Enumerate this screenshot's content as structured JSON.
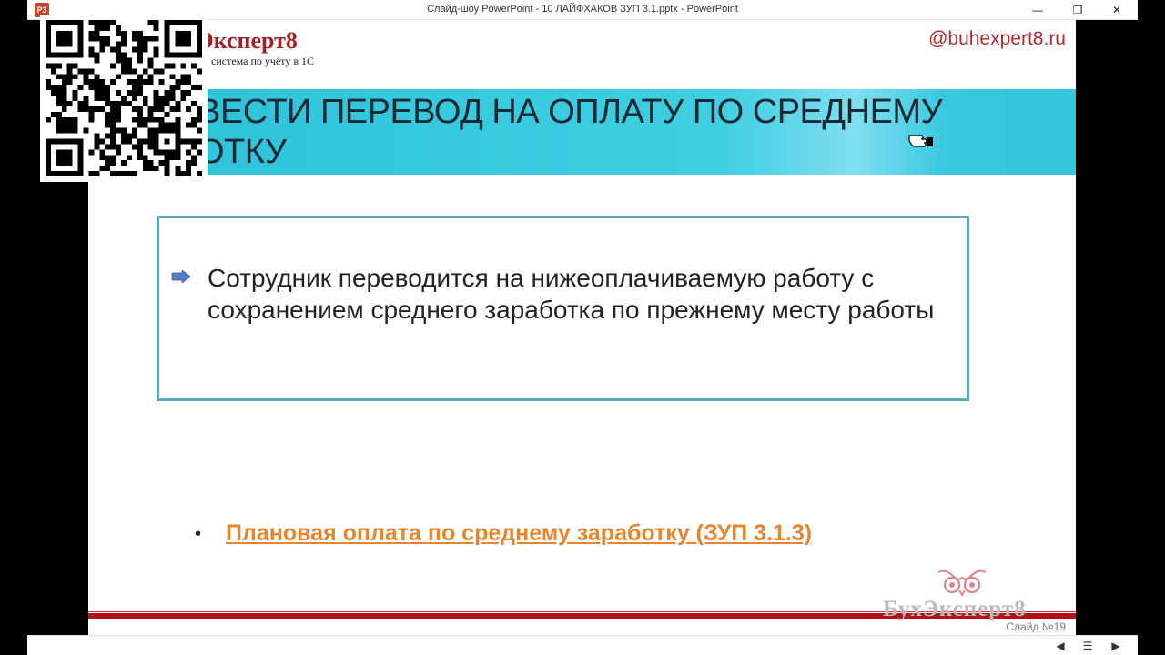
{
  "window": {
    "title": "Слайд-шоу PowerPoint  -  10 ЛАЙФХАКОВ ЗУП 3.1.pptx - PowerPoint",
    "app_icon_label": "P3",
    "minimize": "—",
    "restore": "❐",
    "close": "✕"
  },
  "slide": {
    "logo": "Эксперт8",
    "logo_sub": "система по учёту в 1С",
    "contact": "@buhexpert8.ru",
    "banner_title_line1": "ВЕСТИ ПЕРЕВОД НА ОПЛАТУ ПО СРЕДНЕМУ",
    "banner_title_line2": "ОТКУ",
    "box_text": "Сотрудник переводится на нижеоплачиваемую работу с сохранением среднего заработка по прежнему месту работы",
    "bullet_dot": "•",
    "link_text": "Плановая оплата по среднему заработку (ЗУП 3.1.3)",
    "watermark": "БухЭксперт8",
    "slide_number": "Слайд №19",
    "accent_color": "#b5101a",
    "banner_color": "#36c5dd",
    "link_color": "#e7852e"
  },
  "statusbar": {
    "prev_icon": "◀",
    "menu_icon": "☰",
    "next_icon": "▶"
  },
  "icons": [
    "app-icon",
    "arrow-bullet-icon",
    "owl-logo-icon",
    "qr-code",
    "hand-cursor-icon",
    "previous-icon",
    "menu-icon",
    "next-icon"
  ]
}
